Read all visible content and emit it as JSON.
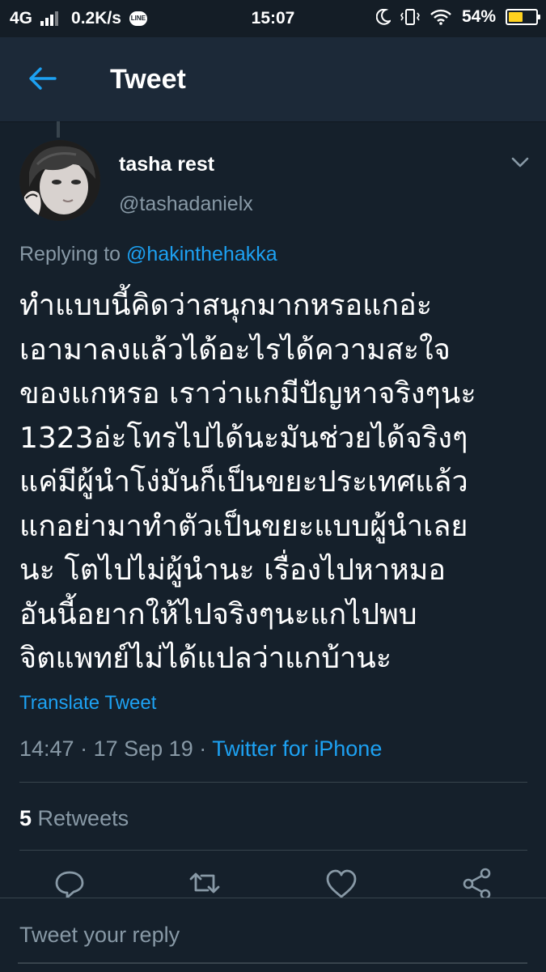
{
  "status_bar": {
    "network": "4G",
    "speed": "0.2K/s",
    "line_badge": "LINE",
    "time": "15:07",
    "battery": "54%",
    "battery_level": 0.54
  },
  "header": {
    "title": "Tweet"
  },
  "tweet": {
    "display_name": "tasha rest",
    "handle": "@tashadanielx",
    "replying_prefix": "Replying to",
    "replying_to": "@hakinthehakka",
    "text_lines": [
      "ทำแบบนี้คิดว่าสนุกมากหรอแกอ่ะ",
      "เอามาลงแล้วได้อะไรได้ความสะใจ",
      "ของแกหรอ เราว่าแกมีปัญหาจริงๆนะ",
      "1323อ่ะโทรไปได้นะมันช่วยได้จริงๆ",
      "แค่มีผู้นำโง่มันก็เป็นขยะประเทศแล้ว",
      "แกอย่ามาทำตัวเป็นขยะแบบผู้นำเลย",
      "นะ โตไปไม่ผู้นำนะ เรื่องไปหาหมอ",
      "อันนี้อยากให้ไปจริงๆนะแกไปพบ",
      "จิตแพทย์ไม่ได้แปลว่าแกบ้านะ"
    ],
    "translate_label": "Translate Tweet",
    "time": "14:47",
    "date": "17 Sep 19",
    "separator": "·",
    "source": "Twitter for iPhone",
    "retweet_count": "5",
    "retweet_label": "Retweets"
  },
  "actions": {
    "reply_icon": "comment-icon",
    "retweet_icon": "retweet-icon",
    "like_icon": "heart-icon",
    "share_icon": "share-icon"
  },
  "reply_box": {
    "placeholder": "Tweet your reply"
  },
  "colors": {
    "background": "#15202b",
    "appbar": "#1c2938",
    "accent": "#1da1f2",
    "secondary_text": "#8899a6",
    "battery_fill": "#ffd21f"
  }
}
